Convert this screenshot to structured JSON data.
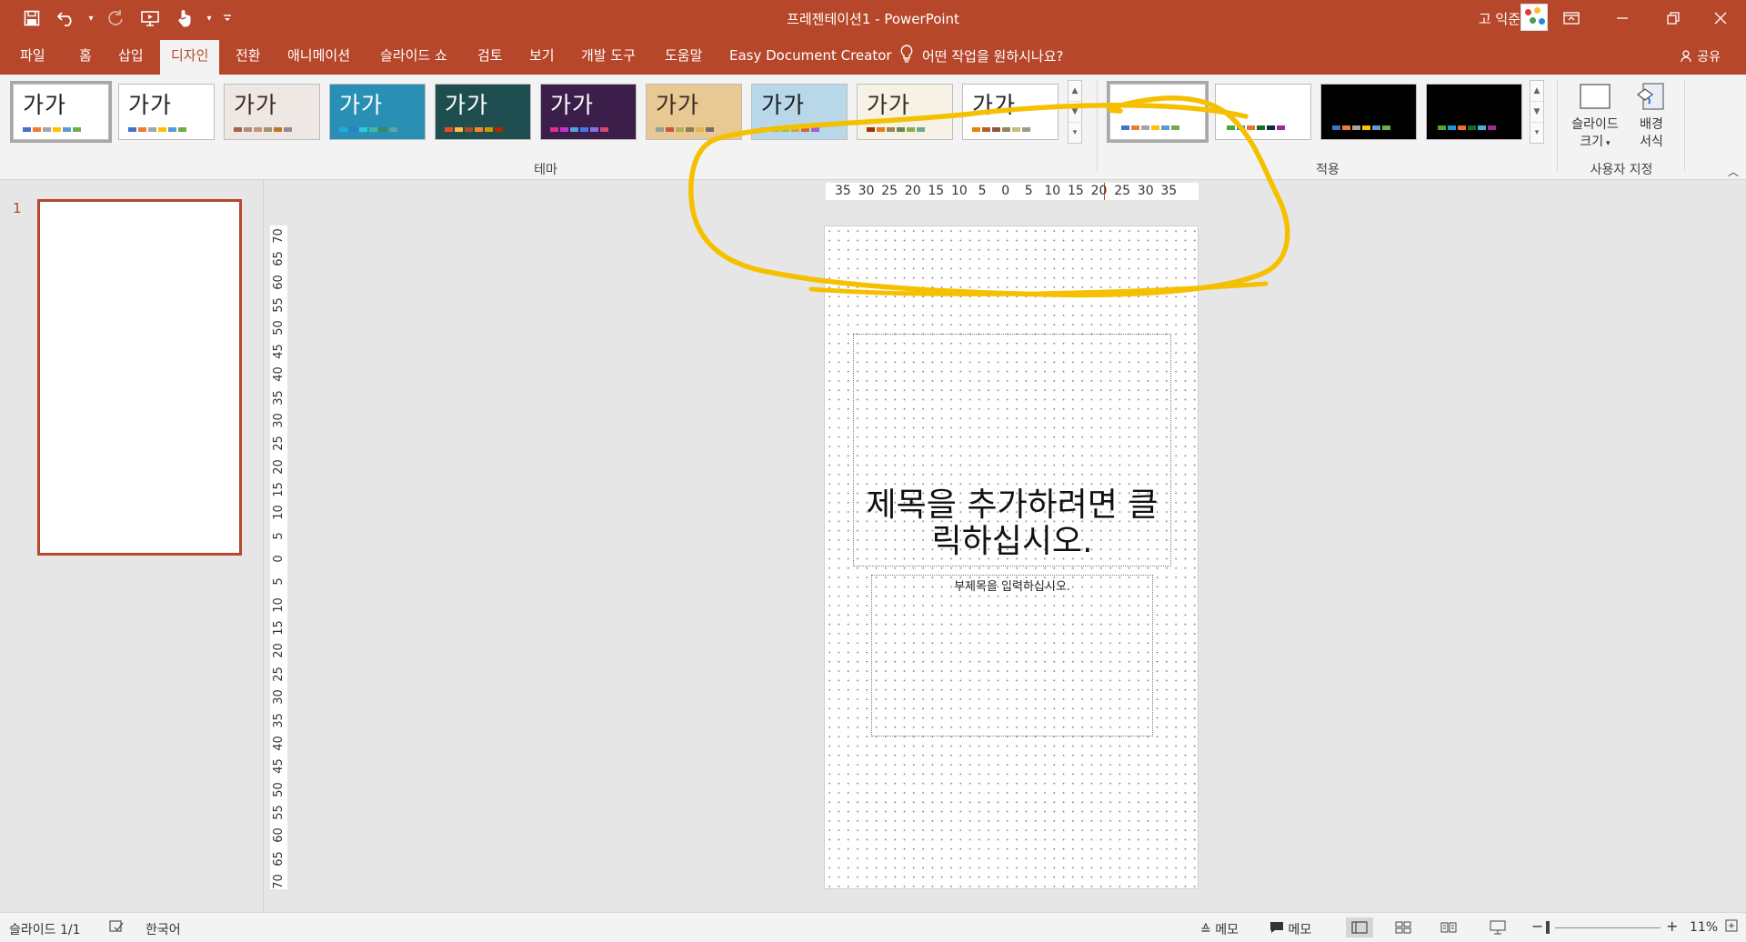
{
  "titlebar": {
    "document_name": "프레젠테이션1 - PowerPoint",
    "user_name": "고 익준",
    "qat": [
      "save-icon",
      "undo-icon",
      "redo-icon",
      "present-from-start-icon",
      "touch-mode-icon",
      "customize-qat-icon"
    ],
    "window_controls": [
      "ribbon-display-options-icon",
      "minimize-icon",
      "restore-icon",
      "close-icon"
    ]
  },
  "tabs": [
    "파일",
    "홈",
    "삽입",
    "디자인",
    "전환",
    "애니메이션",
    "슬라이드 쇼",
    "검토",
    "보기",
    "개발 도구",
    "도움말",
    "Easy Document Creator"
  ],
  "active_tab": "디자인",
  "tell_me": "어떤 작업을 원하시나요?",
  "share": "공유",
  "ribbon": {
    "themes": {
      "group_label": "테마",
      "thumbnail_text": "가가",
      "items": [
        {
          "name": "Office 테마",
          "bg": "#ffffff",
          "fg": "#222222",
          "bars": [
            "#4472c4",
            "#ed7d31",
            "#a5a5a5",
            "#ffc000",
            "#5b9bd5",
            "#70ad47"
          ]
        },
        {
          "name": "Office 테마 2",
          "bg": "#ffffff",
          "fg": "#222222",
          "bars": [
            "#4472c4",
            "#ed7d31",
            "#a5a5a5",
            "#ffc000",
            "#5b9bd5",
            "#70ad47"
          ]
        },
        {
          "name": "테마 3",
          "bg": "#efe7e4",
          "fg": "#3a2a22",
          "bars": [
            "#a5644e",
            "#b58b80",
            "#c3986d",
            "#a19574",
            "#c17529",
            "#8f8f8f"
          ]
        },
        {
          "name": "테마 4",
          "bg": "#2a8fb5",
          "fg": "#ffffff",
          "bars": [
            "#1cade4",
            "#2683c6",
            "#27ced7",
            "#42ba97",
            "#3e8853",
            "#62a39f"
          ]
        },
        {
          "name": "테마 5",
          "bg": "#1f4e50",
          "fg": "#ffffff",
          "bars": [
            "#e84c22",
            "#ffbd47",
            "#b64926",
            "#ff8427",
            "#cc9900",
            "#b22600"
          ]
        },
        {
          "name": "테마 6",
          "bg": "#3c1e4a",
          "fg": "#ffffff",
          "bars": [
            "#e32d91",
            "#c830cc",
            "#4ea6dc",
            "#4775e7",
            "#8971e1",
            "#d54773"
          ]
        },
        {
          "name": "테마 7",
          "bg": "#e8c893",
          "fg": "#3a2a22",
          "bars": [
            "#93a299",
            "#cf543f",
            "#b5ae53",
            "#848058",
            "#e8b54d",
            "#786c71"
          ]
        },
        {
          "name": "테마 8",
          "bg": "#b8d8ea",
          "fg": "#1a1a1a",
          "bars": [
            "#2fa3ee",
            "#4bcaad",
            "#86c157",
            "#d99c3f",
            "#ce6633",
            "#a35dd1"
          ]
        },
        {
          "name": "테마 9",
          "bg": "#f6f3e6",
          "fg": "#3a2a22",
          "bars": [
            "#a53010",
            "#de7e18",
            "#9f8351",
            "#728653",
            "#92aa4c",
            "#6aac91"
          ]
        },
        {
          "name": "테마 10",
          "bg": "#ffffff",
          "fg": "#222222",
          "bars": [
            "#e48312",
            "#bd582c",
            "#865640",
            "#9b8357",
            "#c2bc80",
            "#94a088"
          ]
        }
      ]
    },
    "variants": {
      "group_label": "적용",
      "items": [
        {
          "name": "variant-1",
          "bg": "#ffffff",
          "bars": [
            "#4472c4",
            "#ed7d31",
            "#a5a5a5",
            "#ffc000",
            "#5b9bd5",
            "#70ad47"
          ]
        },
        {
          "name": "variant-2",
          "bg": "#ffffff",
          "bars": [
            "#4ea72e",
            "#0f9ed5",
            "#e97132",
            "#196b24",
            "#0e2841",
            "#a02b93"
          ]
        },
        {
          "name": "variant-3",
          "bg": "#000000",
          "bars": [
            "#4472c4",
            "#ed7d31",
            "#a5a5a5",
            "#ffc000",
            "#5b9bd5",
            "#70ad47"
          ]
        },
        {
          "name": "variant-4",
          "bg": "#000000",
          "bars": [
            "#4ea72e",
            "#0f9ed5",
            "#e97132",
            "#196b24",
            "#46b1e1",
            "#a02b93"
          ]
        }
      ]
    },
    "customize": {
      "group_label": "사용자 지정",
      "slide_size_line1": "슬라이드",
      "slide_size_line2": "크기",
      "format_bg_line1": "배경",
      "format_bg_line2": "서식"
    }
  },
  "slides_panel": {
    "slide_number": "1"
  },
  "ruler": {
    "horizontal": [
      "35",
      "30",
      "25",
      "20",
      "15",
      "10",
      "5",
      "0",
      "5",
      "10",
      "15",
      "20",
      "25",
      "30",
      "35"
    ],
    "vertical": [
      "70",
      "65",
      "60",
      "55",
      "50",
      "45",
      "40",
      "35",
      "30",
      "25",
      "20",
      "15",
      "10",
      "5",
      "0",
      "5",
      "10",
      "15",
      "20",
      "25",
      "30",
      "35",
      "40",
      "45",
      "50",
      "55",
      "60",
      "65",
      "70"
    ]
  },
  "slide": {
    "title_placeholder": "제목을 추가하려면 클릭하십시오.",
    "subtitle_placeholder": "부제목을 입력하십시오."
  },
  "annotation": {
    "color": "#f5c000"
  },
  "status": {
    "slide_counter": "슬라이드 1/1",
    "language": "한국어",
    "notes": "메모",
    "comments": "메모",
    "zoom": "11%"
  },
  "colors": {
    "accent": "#b7472a",
    "ribbon_bg": "#f3f3f3",
    "workspace_bg": "#e6e6e6"
  }
}
